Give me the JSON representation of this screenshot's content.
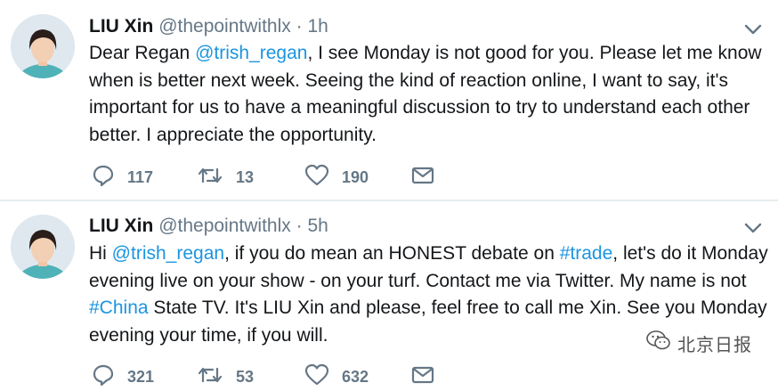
{
  "tweets": [
    {
      "author_name": "LIU Xin",
      "handle": "@thepointwithlx",
      "separator": "·",
      "time": "1h",
      "text_segments": [
        {
          "text": "Dear Regan ",
          "link": false
        },
        {
          "text": "@trish_regan",
          "link": true
        },
        {
          "text": ", I see Monday is not good for you. Please let me know when is better next week.  Seeing the kind of reaction online, I want to say, it's important for us to have a meaningful discussion to try to understand each other better. I appreciate the opportunity.",
          "link": false
        }
      ],
      "reply_count": "117",
      "retweet_count": "13",
      "like_count": "190"
    },
    {
      "author_name": "LIU Xin",
      "handle": "@thepointwithlx",
      "separator": "·",
      "time": "5h",
      "text_segments": [
        {
          "text": "Hi ",
          "link": false
        },
        {
          "text": "@trish_regan",
          "link": true
        },
        {
          "text": ", if you do mean an HONEST debate on ",
          "link": false
        },
        {
          "text": "#trade",
          "link": true
        },
        {
          "text": ", let's do it Monday evening live on your show - on your turf. Contact me via Twitter.  My name is not ",
          "link": false
        },
        {
          "text": "#China",
          "link": true
        },
        {
          "text": " State TV. It's LIU Xin and please, feel free to call me Xin. See you Monday evening your time, if you will.",
          "link": false
        }
      ],
      "reply_count": "321",
      "retweet_count": "53",
      "like_count": "632"
    }
  ],
  "icons": {
    "reply": "reply-icon",
    "retweet": "retweet-icon",
    "like": "heart-icon",
    "dm": "envelope-icon",
    "caret": "chevron-down-icon"
  },
  "colors": {
    "link": "#1b95e0",
    "secondary": "#657786",
    "divider": "#e6ecf0"
  },
  "watermark": {
    "text": "北京日报"
  }
}
